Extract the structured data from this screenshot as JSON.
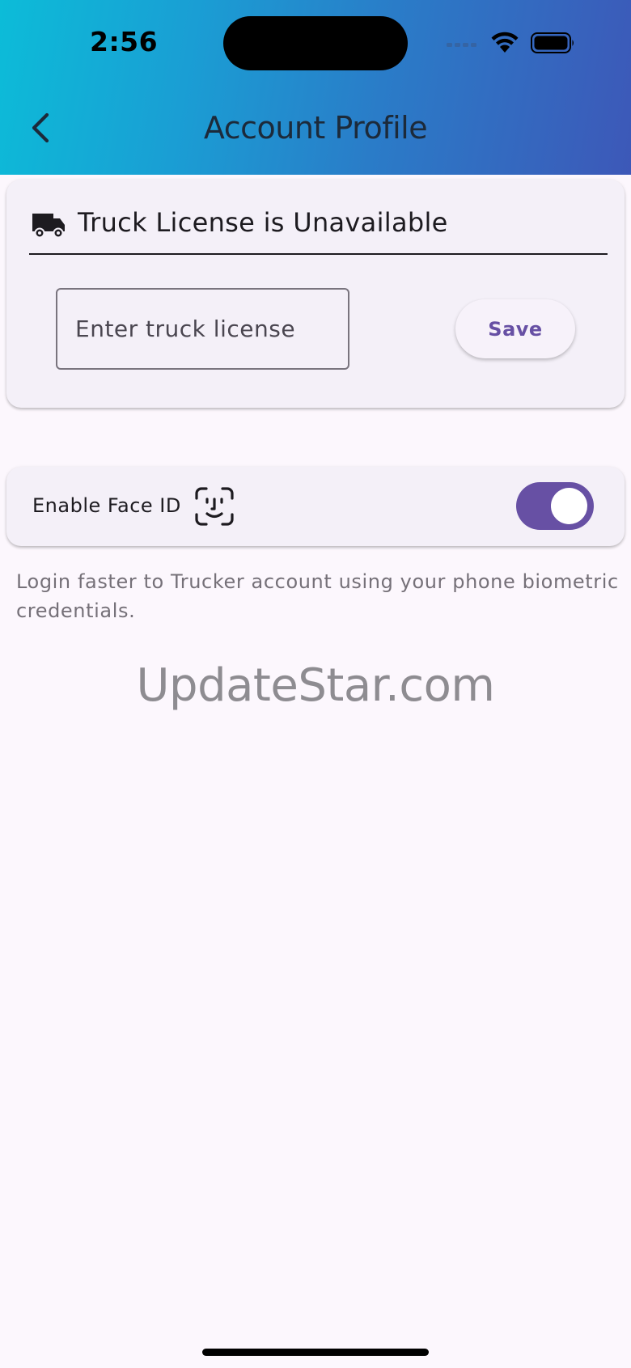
{
  "status_bar": {
    "time": "2:56",
    "icons": [
      "cellular-icon",
      "wifi-icon",
      "battery-icon"
    ]
  },
  "header": {
    "title": "Account Profile",
    "back_icon": "chevron-left-icon",
    "gradient_colors": [
      "#0cbcd8",
      "#3d58b8"
    ]
  },
  "license_card": {
    "icon": "truck-icon",
    "title": "Truck License is Unavailable",
    "input_value": "",
    "input_placeholder": "Enter truck license",
    "save_label": "Save"
  },
  "face_id": {
    "label": "Enable Face ID",
    "icon": "face-id-icon",
    "enabled": true,
    "description": "Login faster to Trucker account using your phone biometric credentials."
  },
  "watermark": "UpdateStar.com",
  "colors": {
    "accent": "#6750a4",
    "background": "#fcf7fd",
    "card": "#f4f0f8"
  }
}
